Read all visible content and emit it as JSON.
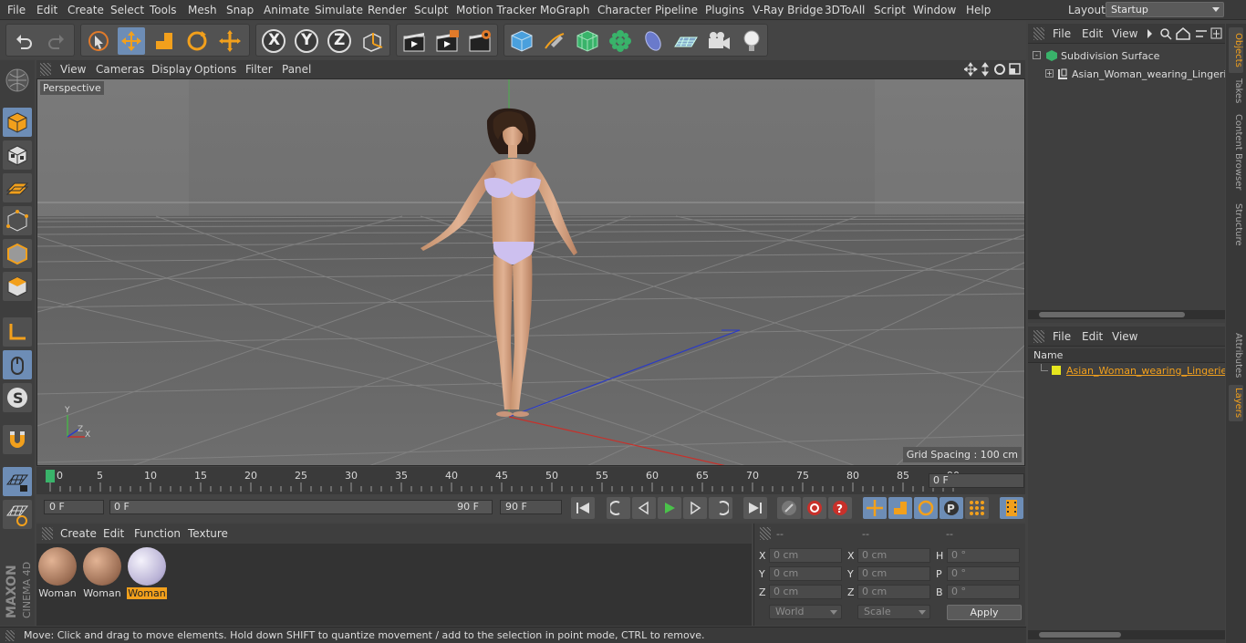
{
  "menubar": {
    "items": [
      "File",
      "Edit",
      "Create",
      "Select",
      "Tools",
      "Mesh",
      "Snap",
      "Animate",
      "Simulate",
      "Render",
      "Sculpt",
      "Motion Tracker",
      "MoGraph",
      "Character",
      "Pipeline",
      "Plugins",
      "V-Ray Bridge",
      "3DToAll",
      "Script",
      "Window",
      "Help"
    ],
    "layout_label": "Layout:",
    "layout_value": "Startup"
  },
  "toolbar": {
    "axis_x": "X",
    "axis_y": "Y",
    "axis_z": "Z"
  },
  "viewport": {
    "menu": [
      "View",
      "Cameras",
      "Display",
      "Options",
      "Filter",
      "Panel"
    ],
    "camera_label": "Perspective",
    "grid_spacing": "Grid Spacing : 100 cm",
    "axis_y_label": "Y",
    "axis_x_label": "X",
    "axis_z_label": "Z"
  },
  "timeline": {
    "ticks": [
      "0",
      "5",
      "10",
      "15",
      "20",
      "25",
      "30",
      "35",
      "40",
      "45",
      "50",
      "55",
      "60",
      "65",
      "70",
      "75",
      "80",
      "85",
      "90"
    ],
    "current_frame": "0 F",
    "start_field": "0 F",
    "range_start": "0 F",
    "range_end": "90 F",
    "end_field": "90 F"
  },
  "materials": {
    "menu": [
      "Create",
      "Edit",
      "Function",
      "Texture"
    ],
    "items": [
      {
        "label": "Woman",
        "selected": false
      },
      {
        "label": "Woman",
        "selected": false
      },
      {
        "label": "Woman",
        "selected": true
      }
    ]
  },
  "coordinates": {
    "col_headers": [
      "--",
      "--",
      "--"
    ],
    "rows": [
      {
        "l1": "X",
        "v1": "0 cm",
        "l2": "X",
        "v2": "0 cm",
        "l3": "H",
        "v3": "0 °"
      },
      {
        "l1": "Y",
        "v1": "0 cm",
        "l2": "Y",
        "v2": "0 cm",
        "l3": "P",
        "v3": "0 °"
      },
      {
        "l1": "Z",
        "v1": "0 cm",
        "l2": "Z",
        "v2": "0 cm",
        "l3": "B",
        "v3": "0 °"
      }
    ],
    "mode_world": "World",
    "mode_scale": "Scale",
    "apply": "Apply"
  },
  "status": {
    "text": "Move: Click and drag to move elements. Hold down SHIFT to quantize movement / add to the selection in point mode, CTRL to remove."
  },
  "objects_panel": {
    "menu": [
      "File",
      "Edit",
      "View"
    ],
    "items": [
      "Subdivision Surface",
      "Asian_Woman_wearing_Lingerie"
    ]
  },
  "layers_panel": {
    "menu": [
      "File",
      "Edit",
      "View"
    ],
    "column_name": "Name",
    "items": [
      "Asian_Woman_wearing_Lingerie_"
    ]
  },
  "right_tabs": [
    "Objects",
    "Takes",
    "Content Browser",
    "Structure",
    "Attributes",
    "Layers"
  ],
  "brand": {
    "maxon": "MAXON",
    "cinema": "CINEMA 4D"
  },
  "colors": {
    "accent": "#f2a01c",
    "selection_blue": "#6d8db6",
    "layer_yellow": "#e6e61e"
  }
}
